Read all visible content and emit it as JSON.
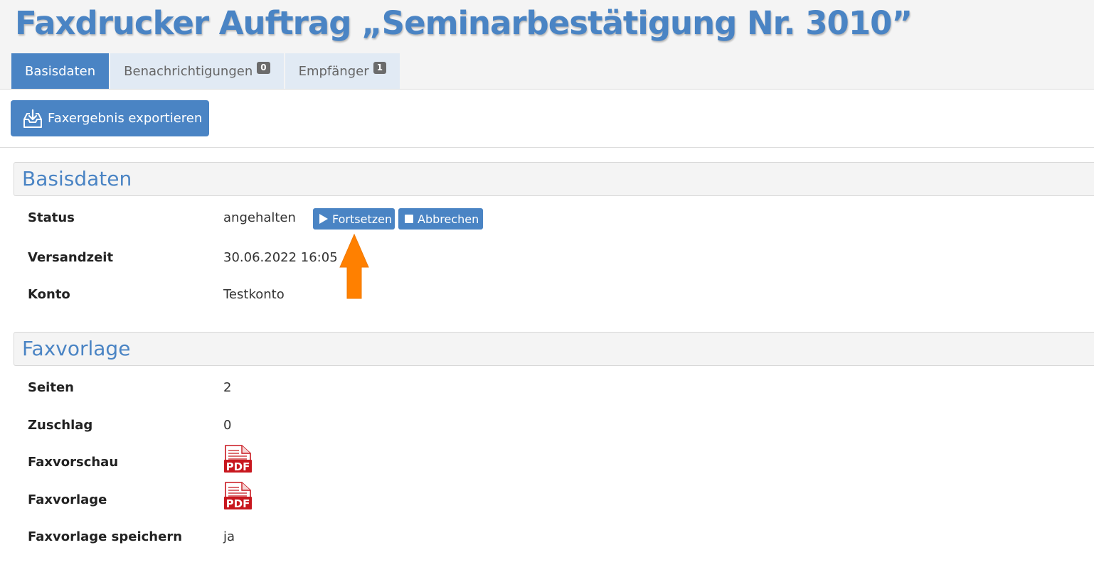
{
  "page": {
    "title": "Faxdrucker Auftrag „Seminarbestätigung Nr. 3010”"
  },
  "tabs": [
    {
      "label": "Basisdaten",
      "active": true
    },
    {
      "label": "Benachrichtigungen",
      "badge": "0"
    },
    {
      "label": "Empfänger",
      "badge": "1"
    }
  ],
  "toolbar": {
    "export_label": "Faxergebnis exportieren",
    "export_icon": "download-tray-icon"
  },
  "basisdaten": {
    "title": "Basisdaten",
    "status_label": "Status",
    "status_value": "angehalten",
    "resume_label": "Fortsetzen",
    "resume_icon": "play-icon",
    "cancel_label": "Abbrechen",
    "cancel_icon": "stop-icon",
    "sendtime_label": "Versandzeit",
    "sendtime_value": "30.06.2022 16:05",
    "account_label": "Konto",
    "account_value": "Testkonto"
  },
  "faxvorlage": {
    "title": "Faxvorlage",
    "pages_label": "Seiten",
    "pages_value": "2",
    "surcharge_label": "Zuschlag",
    "surcharge_value": "0",
    "preview_label": "Faxvorschau",
    "preview_icon": "pdf-file-icon",
    "template_label": "Faxvorlage",
    "template_icon": "pdf-file-icon",
    "save_label": "Faxvorlage speichern",
    "save_value": "ja"
  },
  "colors": {
    "accent": "#4a84c4",
    "annotation_arrow": "#ff8000",
    "pdf_red": "#c8171e"
  }
}
